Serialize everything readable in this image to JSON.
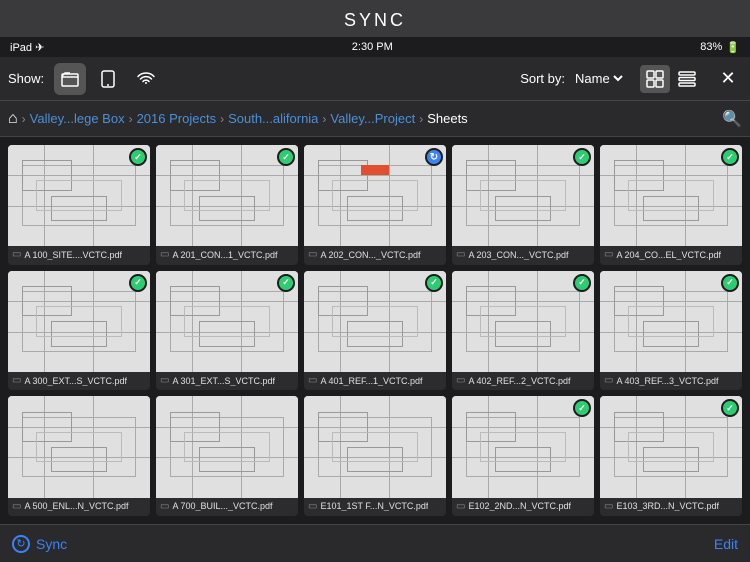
{
  "page": {
    "title": "SYNC"
  },
  "status_bar": {
    "left": "iPad ✈",
    "time": "2:30 PM",
    "battery": "83%",
    "wifi": "▲"
  },
  "toolbar": {
    "show_label": "Show:",
    "sort_label": "Sort by:",
    "sort_value": "Name",
    "icons": {
      "folder": "📁",
      "tablet": "▭",
      "wifi": "((•))"
    }
  },
  "breadcrumb": {
    "home": "⌂",
    "items": [
      {
        "label": "Valley...lege Box",
        "active": false
      },
      {
        "label": "2016 Projects",
        "active": false
      },
      {
        "label": "South...alifornia",
        "active": false
      },
      {
        "label": "Valley...Project",
        "active": false
      },
      {
        "label": "Sheets",
        "active": true
      }
    ]
  },
  "files": [
    {
      "name": "A 100_SITE....VCTC.pdf",
      "badge": "check"
    },
    {
      "name": "A 201_CON...1_VCTC.pdf",
      "badge": "check"
    },
    {
      "name": "A 202_CON..._VCTC.pdf",
      "badge": "blue"
    },
    {
      "name": "A 203_CON..._VCTC.pdf",
      "badge": "check"
    },
    {
      "name": "A 204_CO...EL_VCTC.pdf",
      "badge": "check"
    },
    {
      "name": "A 300_EXT...S_VCTC.pdf",
      "badge": "check"
    },
    {
      "name": "A 301_EXT...S_VCTC.pdf",
      "badge": "check"
    },
    {
      "name": "A 401_REF...1_VCTC.pdf",
      "badge": "check"
    },
    {
      "name": "A 402_REF...2_VCTC.pdf",
      "badge": "check"
    },
    {
      "name": "A 403_REF...3_VCTC.pdf",
      "badge": "check"
    },
    {
      "name": "A 500_ENL...N_VCTC.pdf",
      "badge": "none"
    },
    {
      "name": "A 700_BUIL..._VCTC.pdf",
      "badge": "none"
    },
    {
      "name": "E101_1ST F...N_VCTC.pdf",
      "badge": "none"
    },
    {
      "name": "E102_2ND...N_VCTC.pdf",
      "badge": "check"
    },
    {
      "name": "E103_3RD...N_VCTC.pdf",
      "badge": "check"
    }
  ],
  "bottom": {
    "sync_label": "Sync",
    "edit_label": "Edit"
  }
}
